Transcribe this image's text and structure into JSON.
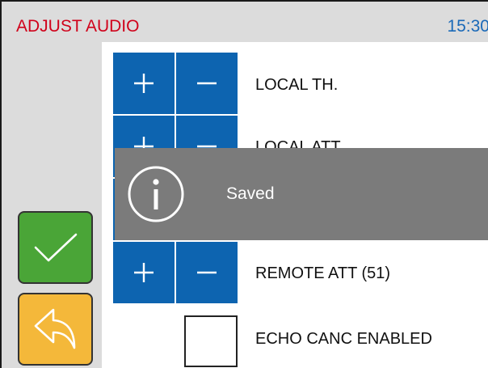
{
  "header": {
    "title": "ADJUST AUDIO",
    "time": "15:30"
  },
  "rows": [
    {
      "plus_label": "+",
      "minus_label": "−",
      "label": "LOCAL TH."
    },
    {
      "plus_label": "+",
      "minus_label": "−",
      "label": "LOCAL ATT."
    },
    {
      "plus_label": "+",
      "minus_label": "−",
      "label": ""
    },
    {
      "plus_label": "+",
      "minus_label": "−",
      "label": "REMOTE ATT (51)"
    }
  ],
  "echo": {
    "label": "ECHO CANC ENABLED",
    "checked": false
  },
  "toast": {
    "message": "Saved",
    "icon": "info-icon"
  },
  "side_buttons": {
    "confirm_icon": "checkmark-icon",
    "back_icon": "back-arrow-icon"
  },
  "colors": {
    "title": "#d0021b",
    "time": "#1a69b8",
    "button_blue": "#0d64b0",
    "confirm_green": "#4aa537",
    "back_orange": "#f4b83a",
    "toast_gray": "#7b7b7b",
    "chrome_gray": "#dcdcdc"
  }
}
